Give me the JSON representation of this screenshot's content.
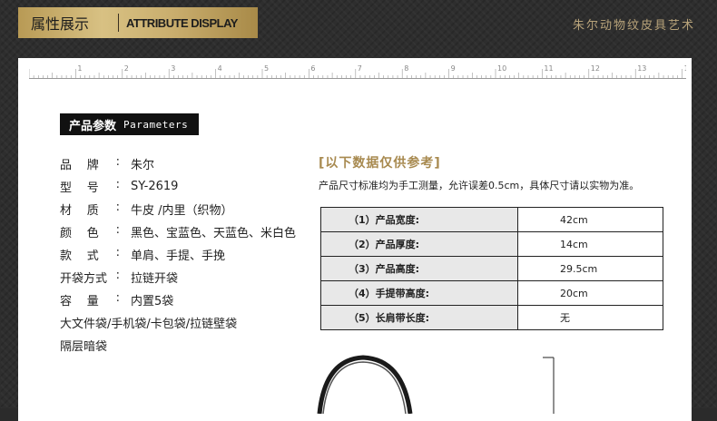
{
  "header": {
    "title_cn": "属性展示",
    "title_en": "ATTRIBUTE DISPLAY",
    "brand": "朱尔动物纹皮具艺术"
  },
  "ruler": {
    "labels": [
      "1",
      "2",
      "3",
      "4",
      "5",
      "6",
      "7",
      "8",
      "9",
      "10",
      "11",
      "12",
      "13",
      "14",
      "15"
    ]
  },
  "params": {
    "title_cn": "产品参数",
    "title_en": "Parameters",
    "rows": [
      {
        "label": [
          "品",
          "牌"
        ],
        "colon": ":",
        "value": "朱尔"
      },
      {
        "label": [
          "型",
          "号"
        ],
        "colon": ":",
        "value": "SY-2619"
      },
      {
        "label": [
          "材",
          "质"
        ],
        "colon": ":",
        "value": "牛皮 /内里（织物）"
      },
      {
        "label": [
          "颜",
          "色"
        ],
        "colon": ":",
        "value": "黑色、宝蓝色、天蓝色、米白色"
      },
      {
        "label": [
          "款",
          "式"
        ],
        "colon": ":",
        "value": "单肩、手提、手挽"
      },
      {
        "label": [
          "开袋方式"
        ],
        "colon": ":",
        "value": "拉链开袋"
      },
      {
        "label": [
          "容",
          "量"
        ],
        "colon": ":",
        "value": "内置5袋"
      }
    ],
    "extra_lines": [
      "大文件袋/手机袋/卡包袋/拉链壁袋",
      "隔层暗袋"
    ]
  },
  "reference": {
    "title": "[以下数据仅供参考]",
    "note": "产品尺寸标准均为手工测量，允许误差0.5cm，具体尺寸请以实物为准。",
    "rows": [
      {
        "label": "（1）产品宽度:",
        "value": "42cm"
      },
      {
        "label": "（2）产品厚度:",
        "value": "14cm"
      },
      {
        "label": "（3）产品高度:",
        "value": "29.5cm"
      },
      {
        "label": "（4）手提带高度:",
        "value": "20cm"
      },
      {
        "label": "（5）长肩带长度:",
        "value": "无"
      }
    ]
  }
}
